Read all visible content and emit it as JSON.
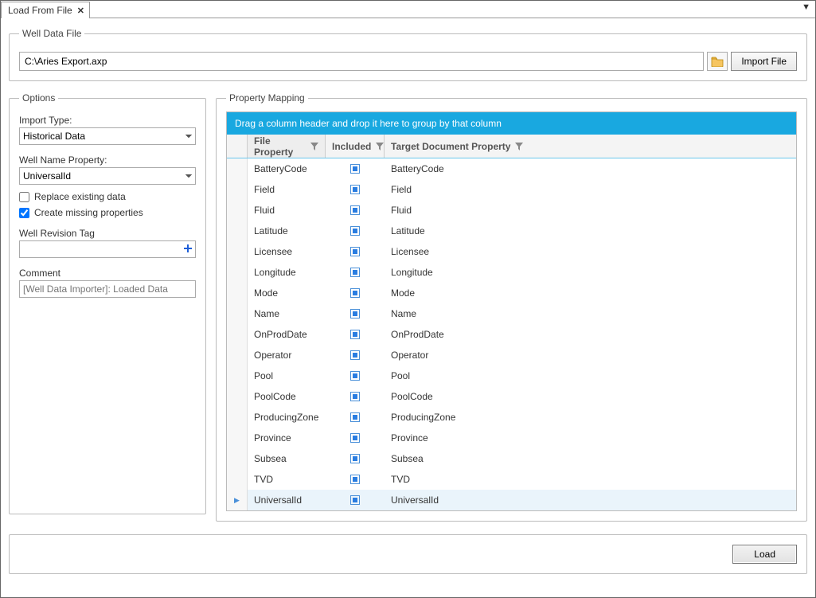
{
  "tab": {
    "title": "Load From File"
  },
  "wellDataFile": {
    "legend": "Well Data File",
    "path": "C:\\Aries Export.axp",
    "importBtn": "Import File"
  },
  "options": {
    "legend": "Options",
    "importTypeLabel": "Import Type:",
    "importTypeValue": "Historical Data",
    "wellNamePropLabel": "Well Name Property:",
    "wellNamePropValue": "UniversalId",
    "replaceExistingLabel": "Replace existing data",
    "replaceExistingChecked": false,
    "createMissingLabel": "Create missing properties",
    "createMissingChecked": true,
    "wellRevisionTagLabel": "Well Revision Tag",
    "wellRevisionTagValue": "",
    "commentLabel": "Comment",
    "commentPlaceholder": "[Well Data Importer]: Loaded Data"
  },
  "mapping": {
    "legend": "Property Mapping",
    "groupBarText": "Drag a column header and drop it here to group by that column",
    "columns": {
      "fileProperty": "File Property",
      "included": "Included",
      "targetDocProperty": "Target Document Property"
    },
    "rows": [
      {
        "file": "BatteryCode",
        "included": true,
        "target": "BatteryCode",
        "selected": false
      },
      {
        "file": "Field",
        "included": true,
        "target": "Field",
        "selected": false
      },
      {
        "file": "Fluid",
        "included": true,
        "target": "Fluid",
        "selected": false
      },
      {
        "file": "Latitude",
        "included": true,
        "target": "Latitude",
        "selected": false
      },
      {
        "file": "Licensee",
        "included": true,
        "target": "Licensee",
        "selected": false
      },
      {
        "file": "Longitude",
        "included": true,
        "target": "Longitude",
        "selected": false
      },
      {
        "file": "Mode",
        "included": true,
        "target": "Mode",
        "selected": false
      },
      {
        "file": "Name",
        "included": true,
        "target": "Name",
        "selected": false
      },
      {
        "file": "OnProdDate",
        "included": true,
        "target": "OnProdDate",
        "selected": false
      },
      {
        "file": "Operator",
        "included": true,
        "target": "Operator",
        "selected": false
      },
      {
        "file": "Pool",
        "included": true,
        "target": "Pool",
        "selected": false
      },
      {
        "file": "PoolCode",
        "included": true,
        "target": "PoolCode",
        "selected": false
      },
      {
        "file": "ProducingZone",
        "included": true,
        "target": "ProducingZone",
        "selected": false
      },
      {
        "file": "Province",
        "included": true,
        "target": "Province",
        "selected": false
      },
      {
        "file": "Subsea",
        "included": true,
        "target": "Subsea",
        "selected": false
      },
      {
        "file": "TVD",
        "included": true,
        "target": "TVD",
        "selected": false
      },
      {
        "file": "UniversalId",
        "included": true,
        "target": "UniversalId",
        "selected": true
      }
    ]
  },
  "footer": {
    "loadBtn": "Load"
  }
}
